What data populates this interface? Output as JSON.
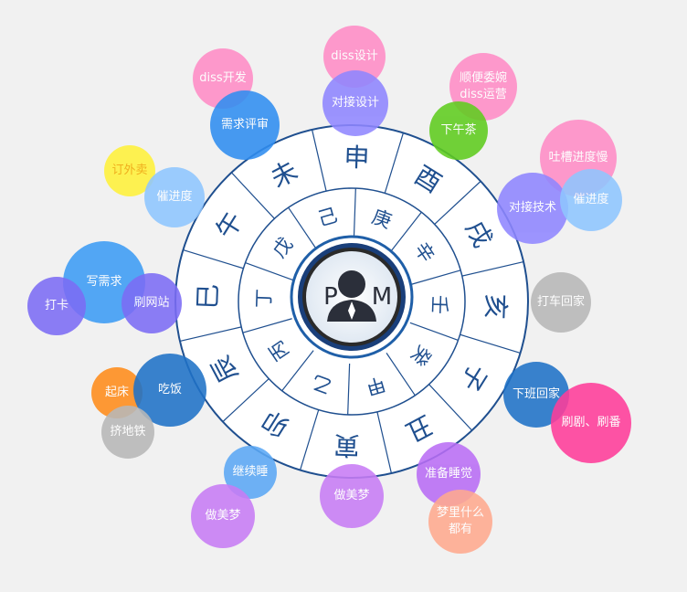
{
  "wheel": {
    "center_labels": {
      "left": "P",
      "right": "M"
    },
    "outer_ring": [
      "申",
      "酉",
      "戌",
      "亥",
      "子",
      "丑",
      "寅",
      "卯",
      "辰",
      "巳",
      "午",
      "未"
    ],
    "inner_ring": [
      "庚",
      "辛",
      "壬",
      "癸",
      "甲",
      "乙",
      "丙",
      "丁",
      "戊",
      "己"
    ]
  },
  "bubbles": [
    {
      "id": "diss-design",
      "text": "diss设计",
      "color": "#ff8cc6"
    },
    {
      "id": "diss-dev",
      "text": "diss开发",
      "color": "#ff8cc6"
    },
    {
      "id": "shunbian",
      "text": "顺便委婉\ndiss运营",
      "color": "#ff8cc6"
    },
    {
      "id": "connect-design",
      "text": "对接设计",
      "color": "#8f86ff"
    },
    {
      "id": "req-review",
      "text": "需求评审",
      "color": "#2f8df0"
    },
    {
      "id": "tea",
      "text": "下午茶",
      "color": "#5fcc1e"
    },
    {
      "id": "complain",
      "text": "吐槽进度慢",
      "color": "#ff8cc6"
    },
    {
      "id": "connect-tech",
      "text": "对接技术",
      "color": "#8f86ff"
    },
    {
      "id": "urge-right",
      "text": "催进度",
      "color": "#8fc6ff"
    },
    {
      "id": "order",
      "text": "订外卖",
      "color": "#fff23a",
      "textColor": "#f0a500"
    },
    {
      "id": "urge-left",
      "text": "催进度",
      "color": "#8fc6ff"
    },
    {
      "id": "write-req",
      "text": "写需求",
      "color": "#3d9cf5"
    },
    {
      "id": "clock-in",
      "text": "打卡",
      "color": "#7c6cf5"
    },
    {
      "id": "browse",
      "text": "刷网站",
      "color": "#7c6cf5"
    },
    {
      "id": "taxi-home",
      "text": "打车回家",
      "color": "#b8b8b8"
    },
    {
      "id": "wake",
      "text": "起床",
      "color": "#ff8c1a"
    },
    {
      "id": "eat",
      "text": "吃饭",
      "color": "#1f72c7"
    },
    {
      "id": "subway",
      "text": "挤地铁",
      "color": "#b8b8b8"
    },
    {
      "id": "off-work",
      "text": "下班回家",
      "color": "#1f72c7"
    },
    {
      "id": "binge",
      "text": "刷剧、刷番",
      "color": "#ff3d9a"
    },
    {
      "id": "keep-sleep",
      "text": "继续睡",
      "color": "#5ba8f5"
    },
    {
      "id": "sleep-prep",
      "text": "准备睡觉",
      "color": "#b96df5"
    },
    {
      "id": "dream1",
      "text": "做美梦",
      "color": "#c87cf5"
    },
    {
      "id": "dream2",
      "text": "做美梦",
      "color": "#c87cf5"
    },
    {
      "id": "dream-all",
      "text": "梦里什么\n都有",
      "color": "#ffaa8f"
    }
  ]
}
